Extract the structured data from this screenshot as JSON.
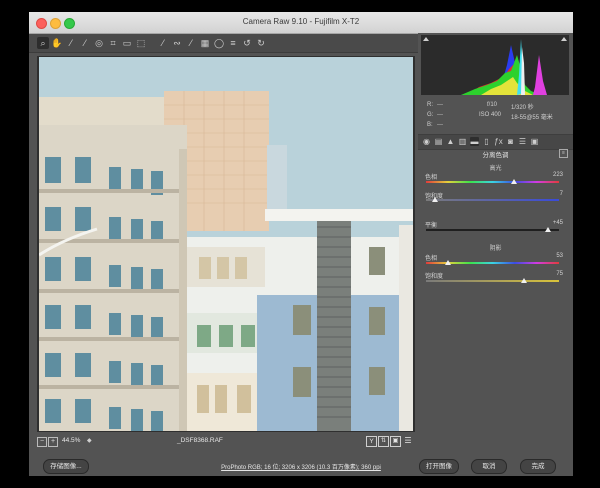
{
  "window": {
    "title": "Camera Raw 9.10 - Fujifilm X-T2"
  },
  "toolbar": {
    "tools": [
      {
        "name": "zoom-tool-icon",
        "glyph": "⌕"
      },
      {
        "name": "hand-tool-icon",
        "glyph": "✋"
      },
      {
        "name": "white-balance-tool-icon",
        "glyph": "⁄"
      },
      {
        "name": "color-sampler-tool-icon",
        "glyph": "⁄"
      },
      {
        "name": "targeted-adjustment-tool-icon",
        "glyph": "◎"
      },
      {
        "name": "crop-tool-icon",
        "glyph": "⌗"
      },
      {
        "name": "straighten-tool-icon",
        "glyph": "▭"
      },
      {
        "name": "transform-tool-icon",
        "glyph": "⬚"
      },
      {
        "name": "spot-removal-tool-icon",
        "glyph": "⁄"
      },
      {
        "name": "red-eye-tool-icon",
        "glyph": "∾"
      },
      {
        "name": "adjustment-brush-icon",
        "glyph": "⁄"
      },
      {
        "name": "graduated-filter-icon",
        "glyph": "▦"
      },
      {
        "name": "radial-filter-icon",
        "glyph": "◯"
      },
      {
        "name": "preferences-icon",
        "glyph": "≡"
      },
      {
        "name": "rotate-left-icon",
        "glyph": "↺"
      },
      {
        "name": "rotate-right-icon",
        "glyph": "↻"
      }
    ],
    "fullscreen_glyph": "⇱"
  },
  "readout": {
    "r_label": "R:",
    "g_label": "G:",
    "b_label": "B:",
    "dash": "---",
    "aperture": "f/10",
    "shutter": "1/320 秒",
    "iso": "ISO 400",
    "lens": "18-55@55 毫米"
  },
  "panel": {
    "title": "分离色调",
    "highlights": {
      "title": "高光",
      "hue_label": "色相",
      "hue_value": "223",
      "sat_label": "饱和度",
      "sat_value": "7"
    },
    "balance": {
      "label": "平衡",
      "value": "+45"
    },
    "shadows": {
      "title": "阴影",
      "hue_label": "色相",
      "hue_value": "53",
      "sat_label": "饱和度",
      "sat_value": "75"
    },
    "accent": "#e8e8e8"
  },
  "status": {
    "zoom": "44.5%",
    "filename": "_DSF8368.RAF",
    "zoom_out": "−",
    "zoom_in": "+"
  },
  "bottom": {
    "save_label": "存储图像...",
    "workflow_info": "ProPhoto RGB; 16 位; 3206 x 3206 (10.3 百万像素); 360 ppi",
    "open_label": "打开图像",
    "cancel_label": "取消",
    "done_label": "完成"
  }
}
